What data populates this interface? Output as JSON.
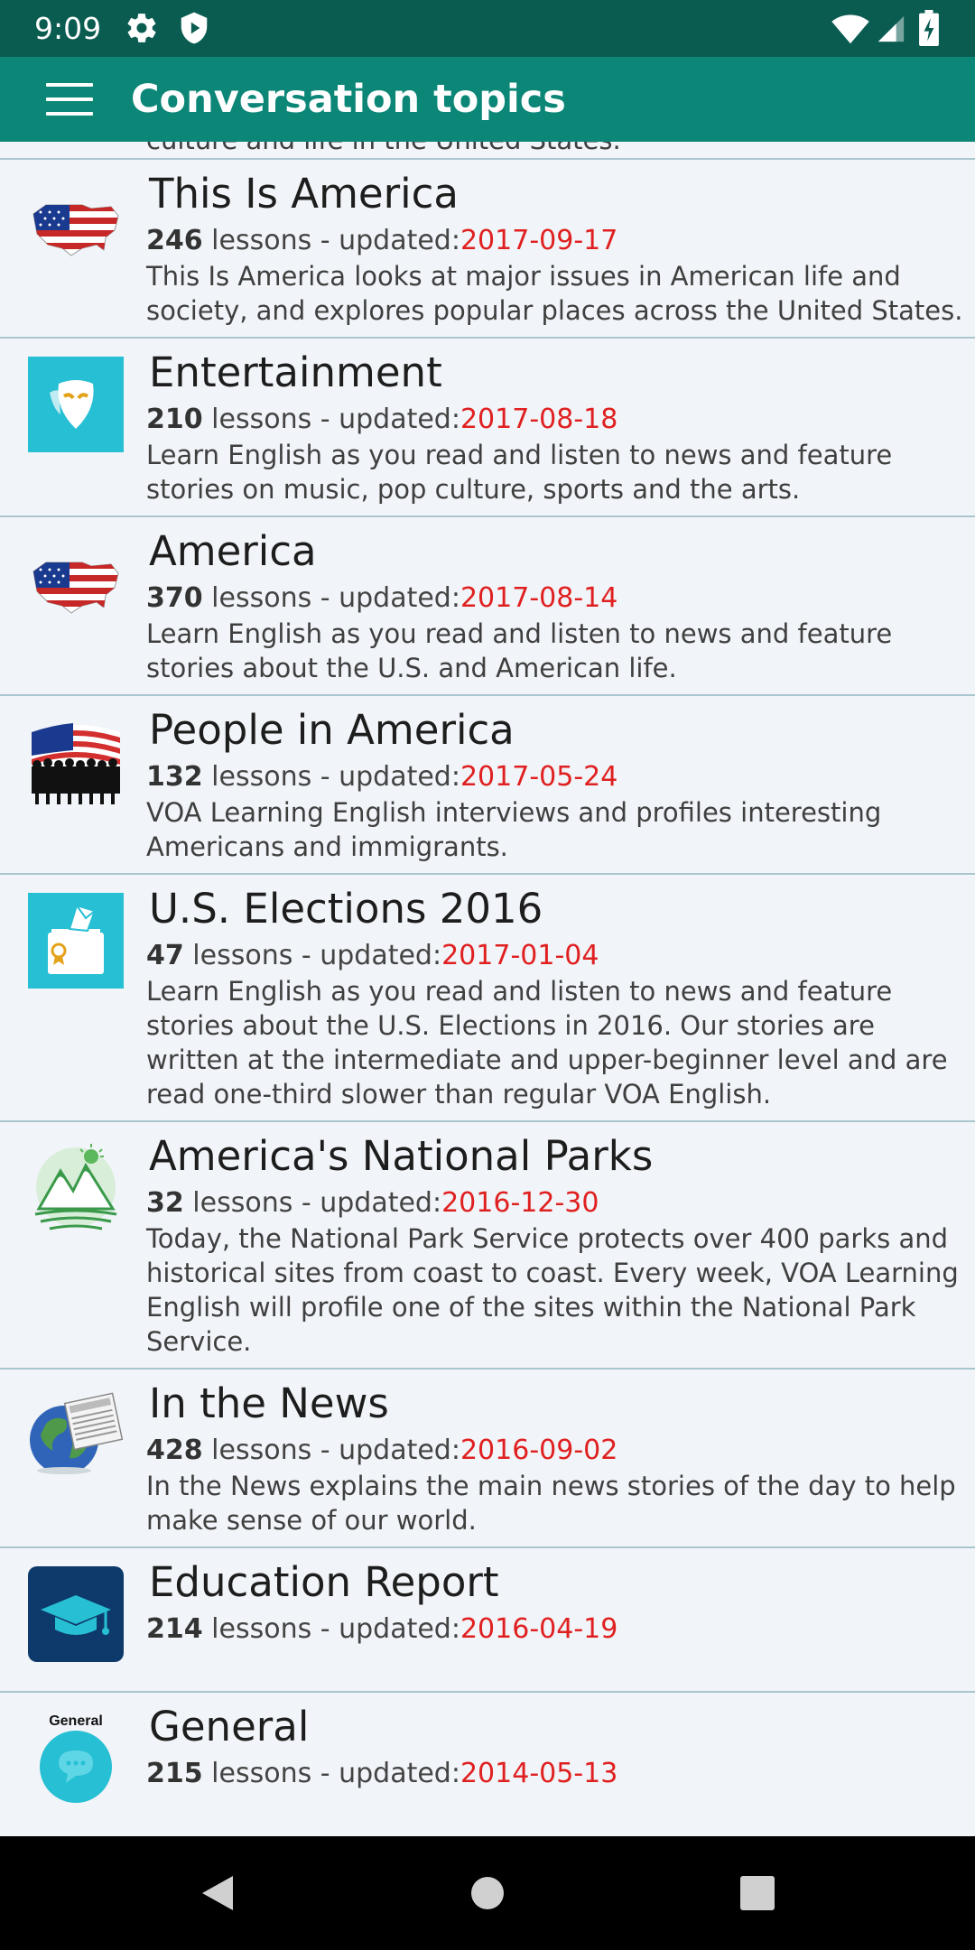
{
  "status_bar": {
    "time": "9:09",
    "icons": [
      "gear-icon",
      "shield-icon",
      "wifi-icon",
      "signal-icon",
      "battery-icon"
    ]
  },
  "app_bar": {
    "title": "Conversation topics",
    "menu_icon": "menu-icon",
    "background": "#0b8677"
  },
  "clipped_previous_description": "culture and life in the United States.",
  "topics": [
    {
      "title": "This Is America",
      "count": "246",
      "meta_text": " lessons - updated:",
      "date": "2017-09-17",
      "description": "This Is America looks at major issues in American life and society, and explores popular places across the United States.",
      "icon": "us-map-flag-icon"
    },
    {
      "title": "Entertainment",
      "count": "210",
      "meta_text": " lessons - updated:",
      "date": "2017-08-18",
      "description": "Learn English as you read and listen to news and feature stories on music, pop culture, sports and the arts.",
      "icon": "theater-mask-icon"
    },
    {
      "title": "America",
      "count": "370",
      "meta_text": " lessons - updated:",
      "date": "2017-08-14",
      "description": "Learn English as you read and listen to news and feature stories about the U.S. and American life.",
      "icon": "us-map-flag-icon"
    },
    {
      "title": "People in America",
      "count": "132",
      "meta_text": " lessons - updated:",
      "date": "2017-05-24",
      "description": "VOA Learning English interviews and profiles interesting Americans and immigrants.",
      "icon": "flag-crowd-icon"
    },
    {
      "title": "U.S. Elections 2016",
      "count": "47",
      "meta_text": " lessons - updated:",
      "date": "2017-01-04",
      "description": "Learn English as you read and listen to news and feature stories about the U.S. Elections in 2016. Our stories are written at the intermediate and upper-beginner level and are read one-third slower than regular VOA English.",
      "icon": "ballot-box-icon"
    },
    {
      "title": "America's National Parks",
      "count": "32",
      "meta_text": " lessons - updated:",
      "date": "2016-12-30",
      "description": "Today, the National Park Service protects over 400 parks and historical sites from coast to coast. Every week, VOA Learning English will profile one of the sites within the National Park Service.",
      "icon": "mountains-icon"
    },
    {
      "title": "In the News",
      "count": "428",
      "meta_text": " lessons - updated:",
      "date": "2016-09-02",
      "description": "In the News explains the main news stories of the day to help make sense of our world.",
      "icon": "globe-newspaper-icon"
    },
    {
      "title": "Education Report",
      "count": "214",
      "meta_text": " lessons - updated:",
      "date": "2016-04-19",
      "description": "",
      "icon": "graduation-cap-icon"
    },
    {
      "title": "General",
      "count": "215",
      "meta_text": " lessons - updated:",
      "date": "2014-05-13",
      "description": "",
      "icon": "chat-bubble-icon",
      "icon_label": "General"
    }
  ],
  "nav_bar": {
    "icons": [
      "back-icon",
      "home-icon",
      "recents-icon"
    ]
  },
  "colors": {
    "status_bar": "#0a5c51",
    "app_bar": "#0b8677",
    "date": "#e02020",
    "divider": "#a9c6cf",
    "background": "#f1f4f8"
  }
}
